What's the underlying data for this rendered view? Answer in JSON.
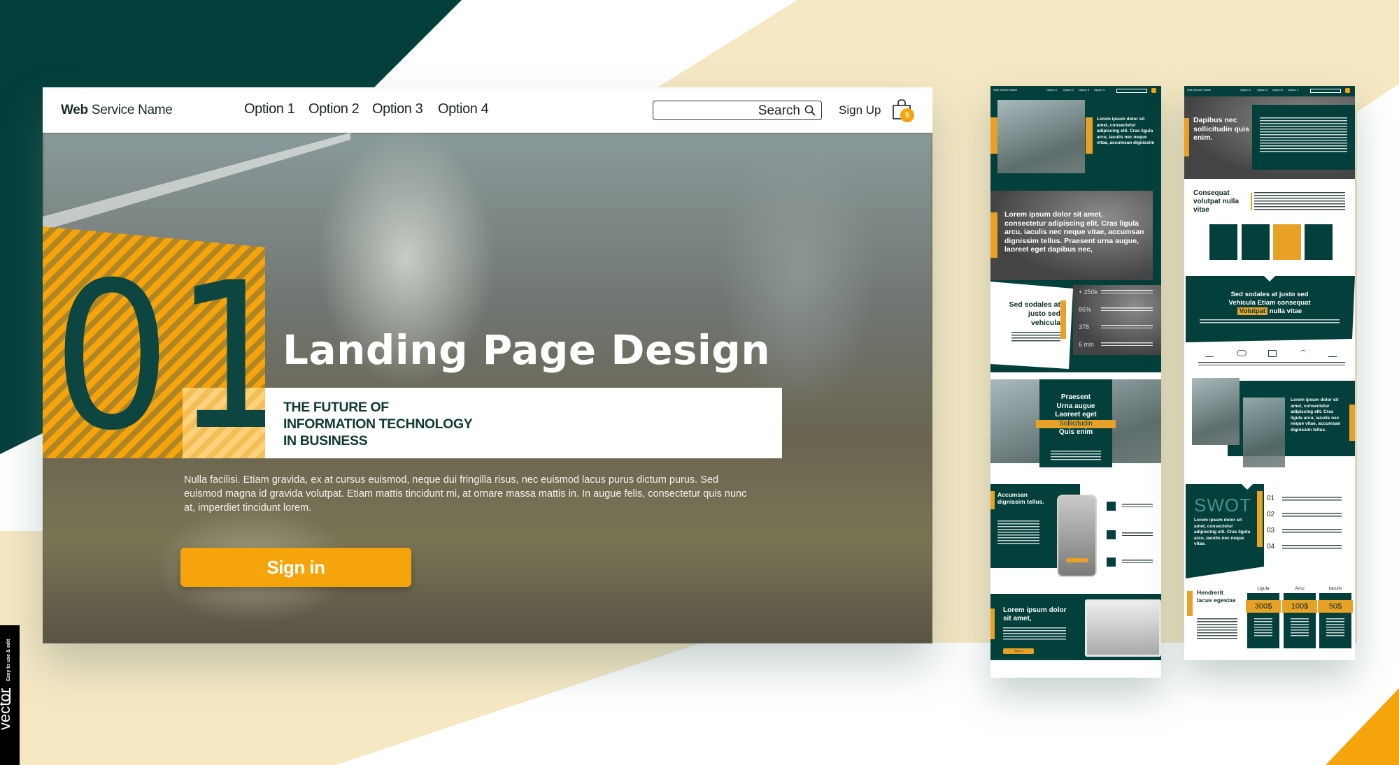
{
  "colors": {
    "brand_green": "#033f3b",
    "accent_orange": "#f6a40c",
    "cream": "#f6e8c3"
  },
  "main_page": {
    "nav": {
      "brand_bold": "Web",
      "brand_rest": " Service Name",
      "items": [
        "Option 1",
        "Option 2",
        "Option 3",
        "Option 4"
      ],
      "search_placeholder": "Search",
      "search_icon": "search-icon",
      "signup_label": "Sign Up",
      "cart_icon": "shopping-bag-icon",
      "cart_count": "5"
    },
    "hero": {
      "number": "01",
      "title": "Landing Page Design",
      "subtitle_lines": [
        "THE FUTURE OF",
        "INFORMATION TECHNOLOGY",
        "IN BUSINESS"
      ],
      "body": "Nulla facilisi. Etiam gravida, ex at cursus euismod, neque dui fringilla risus, nec euismod lacus purus dictum purus. Sed euismod magna id gravida volutpat. Etiam mattis tincidunt mi, at ornare massa mattis in. In augue felis, consectetur quis nunc at, imperdiet tincidunt lorem.",
      "cta_label": "Sign in"
    }
  },
  "mini_page_1": {
    "nav": {
      "brand": "Web Service Name",
      "items": [
        "Option 1",
        "Option 2",
        "Option 3",
        "Option 4"
      ],
      "search": "Search"
    },
    "intro_text": "Lorem ipsum dolor sit amet, consectetur adipiscing elit. Cras ligula arcu, iaculis nec neque vitae, accumsan dignissim",
    "banner_text": "Lorem ipsum dolor sit amet, consectetur adipiscing elit. Cras ligula arcu, iaculis nec neque vitae, accumsan dignissim tellus. Praesent urna augue, laoreet eget dapibus nec,",
    "stats_heading": "Sed sodales at justo sed vehicula",
    "stats": [
      "+ 250k",
      "86%",
      "378",
      "6 min"
    ],
    "feature_lines": [
      "Praesent",
      "Urna augue",
      "Laoreet eget",
      "Sollicitudin",
      "Quis enim"
    ],
    "app_heading": "Accumsan dignissim tellus.",
    "footer_heading": "Lorem ipsum dolor sit amet,",
    "footer_button": "Sign in"
  },
  "mini_page_2": {
    "nav": {
      "brand": "Web Service Name",
      "items": [
        "Option 1",
        "Option 2",
        "Option 3",
        "Option 4"
      ],
      "search": "Search"
    },
    "hero_heading": "Dapibus nec sollicitudin quis enim.",
    "section_heading": "Consequat volutpat nulla vitae",
    "band_lines": [
      "Sed sodales at justo sed",
      "Vehicula Etiam consequat"
    ],
    "band_highlight": "Volutpat",
    "band_tail": " nulla vitae",
    "photo_text": "Lorem ipsum dolor sit amet, consectetur adipiscing elit. Cras ligula arcu, iaculis nec neque vitae, accumsan dignissim tellus.",
    "swot_title": "SWOT",
    "swot_text": "Lorem ipsum dolor sit amet, consectetur adipiscing elit. Cras ligula arcu, iaculis nec neque vitae.",
    "swot_numbers": [
      "01",
      "02",
      "03",
      "04"
    ],
    "pricing_heading": "Hendrerit lacus egestas",
    "pricing": [
      {
        "name": "Ligula",
        "price": "300$"
      },
      {
        "name": "Arcu",
        "price": "100$"
      },
      {
        "name": "Iaculis",
        "price": "50$"
      }
    ]
  },
  "watermark": {
    "word": "vector",
    "tagline": "Easy to use & edit"
  }
}
